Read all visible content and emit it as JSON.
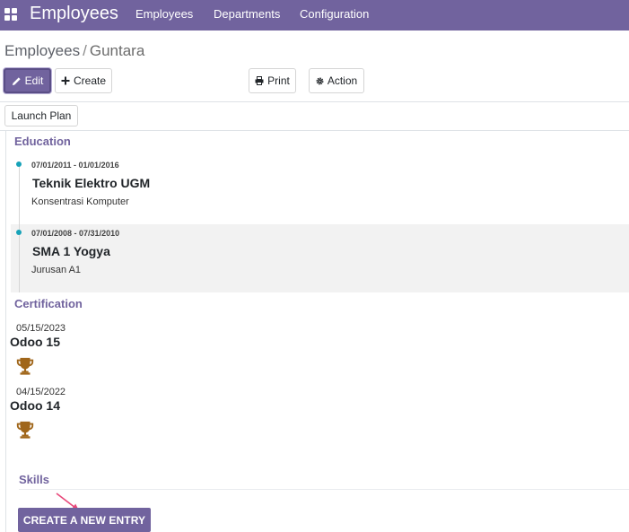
{
  "navbar": {
    "app_name": "Employees",
    "menu": [
      "Employees",
      "Departments",
      "Configuration"
    ]
  },
  "breadcrumb": {
    "parent": "Employees",
    "separator": "/",
    "current": "Guntara"
  },
  "toolbar": {
    "edit_label": "Edit",
    "create_label": "Create",
    "print_label": "Print",
    "action_label": "Action",
    "launch_plan_label": "Launch Plan"
  },
  "education": {
    "title": "Education",
    "entries": [
      {
        "dates": "07/01/2011 - 01/01/2016",
        "name": "Teknik Elektro UGM",
        "description": "Konsentrasi Komputer"
      },
      {
        "dates": "07/01/2008 - 07/31/2010",
        "name": "SMA 1 Yogya",
        "description": "Jurusan A1"
      }
    ]
  },
  "certification": {
    "title": "Certification",
    "entries": [
      {
        "date": "05/15/2023",
        "name": "Odoo 15",
        "icon": "trophy-icon"
      },
      {
        "date": "04/15/2022",
        "name": "Odoo 14",
        "icon": "trophy-icon"
      }
    ]
  },
  "skills": {
    "title": "Skills",
    "create_entry_label": "CREATE A NEW ENTRY"
  },
  "colors": {
    "brand": "#71639e",
    "timeline_dot": "#17a2b8",
    "trophy": "#a0661a",
    "arrow": "#e8487a"
  }
}
